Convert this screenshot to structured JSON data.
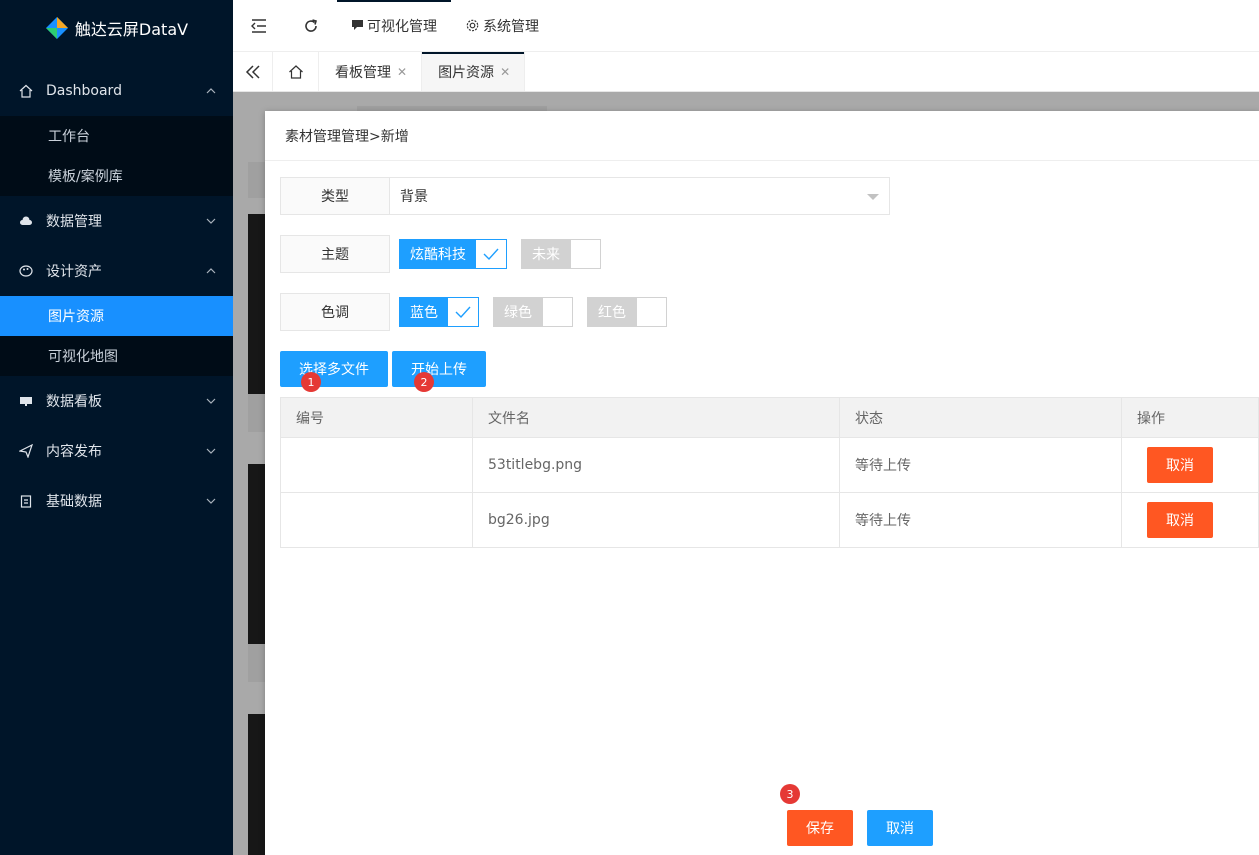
{
  "app": {
    "title": "触达云屏DataV"
  },
  "sidebar": {
    "groups": [
      {
        "label": "Dashboard",
        "icon": "home-icon",
        "expanded": true,
        "items": [
          {
            "label": "工作台"
          },
          {
            "label": "模板/案例库"
          }
        ]
      },
      {
        "label": "数据管理",
        "icon": "cloud-icon",
        "expanded": false
      },
      {
        "label": "设计资产",
        "icon": "palette-icon",
        "expanded": true,
        "items": [
          {
            "label": "图片资源",
            "active": true
          },
          {
            "label": "可视化地图"
          }
        ]
      },
      {
        "label": "数据看板",
        "icon": "board-icon",
        "expanded": false
      },
      {
        "label": "内容发布",
        "icon": "send-icon",
        "expanded": false
      },
      {
        "label": "基础数据",
        "icon": "clipboard-icon",
        "expanded": false
      }
    ]
  },
  "topbar": {
    "links": [
      {
        "label": "可视化管理",
        "icon": "chat-icon"
      },
      {
        "label": "系统管理",
        "icon": "gear-icon"
      }
    ]
  },
  "tabs": [
    {
      "label": "看板管理"
    },
    {
      "label": "图片资源",
      "active": true
    }
  ],
  "modal": {
    "title": "素材管理管理>新增",
    "type": {
      "label": "类型",
      "value": "背景"
    },
    "theme": {
      "label": "主题",
      "options": [
        {
          "label": "炫酷科技",
          "checked": true
        },
        {
          "label": "未来",
          "checked": false
        }
      ]
    },
    "tone": {
      "label": "色调",
      "options": [
        {
          "label": "蓝色",
          "checked": true
        },
        {
          "label": "绿色",
          "checked": false
        },
        {
          "label": "红色",
          "checked": false
        }
      ]
    },
    "select_files_label": "选择多文件",
    "start_upload_label": "开始上传",
    "step_badges": [
      "1",
      "2",
      "3"
    ],
    "table": {
      "headers": [
        "编号",
        "文件名",
        "状态",
        "操作"
      ],
      "rows": [
        {
          "id": "",
          "filename": "53titlebg.png",
          "status": "等待上传",
          "action": "取消"
        },
        {
          "id": "",
          "filename": "bg26.jpg",
          "status": "等待上传",
          "action": "取消"
        }
      ]
    },
    "save_label": "保存",
    "cancel_label": "取消"
  },
  "colors": {
    "sidebar_bg": "#001529",
    "active_blue": "#1890ff",
    "button_blue": "#1e9fff",
    "button_orange": "#ff5722",
    "badge_red": "#e53935"
  }
}
